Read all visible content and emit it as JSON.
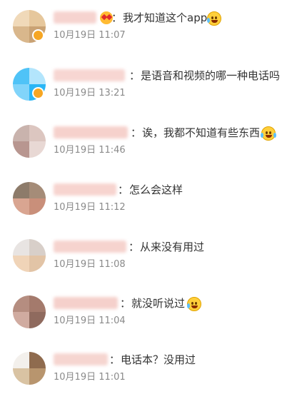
{
  "comments": [
    {
      "text": "我才知道这个app",
      "time": "10月19日 11:07",
      "emoji": "crying-laughing-icon",
      "prefix_emoji": "heart-eyes-icon"
    },
    {
      "text": "是语音和视频的哪一种电话吗",
      "time": "10月19日 13:21"
    },
    {
      "text": "诶，我都不知道有些东西",
      "time": "10月19日 11:46",
      "emoji": "laughing-tears-icon"
    },
    {
      "text": "怎么会这样",
      "time": "10月19日 11:12"
    },
    {
      "text": "从来没有用过",
      "time": "10月19日 11:08"
    },
    {
      "text": "就没听说过",
      "time": "10月19日 11:04",
      "emoji": "crying-laughing-icon"
    },
    {
      "text": "电话本？没用过",
      "time": "10月19日 11:01"
    }
  ],
  "separator": "：",
  "colors": {
    "text": "#333333",
    "time": "#8a8a8a",
    "blurred_name": "#f6c9c4",
    "badge": "#f6a623",
    "emoji": "#ffcf3b"
  }
}
